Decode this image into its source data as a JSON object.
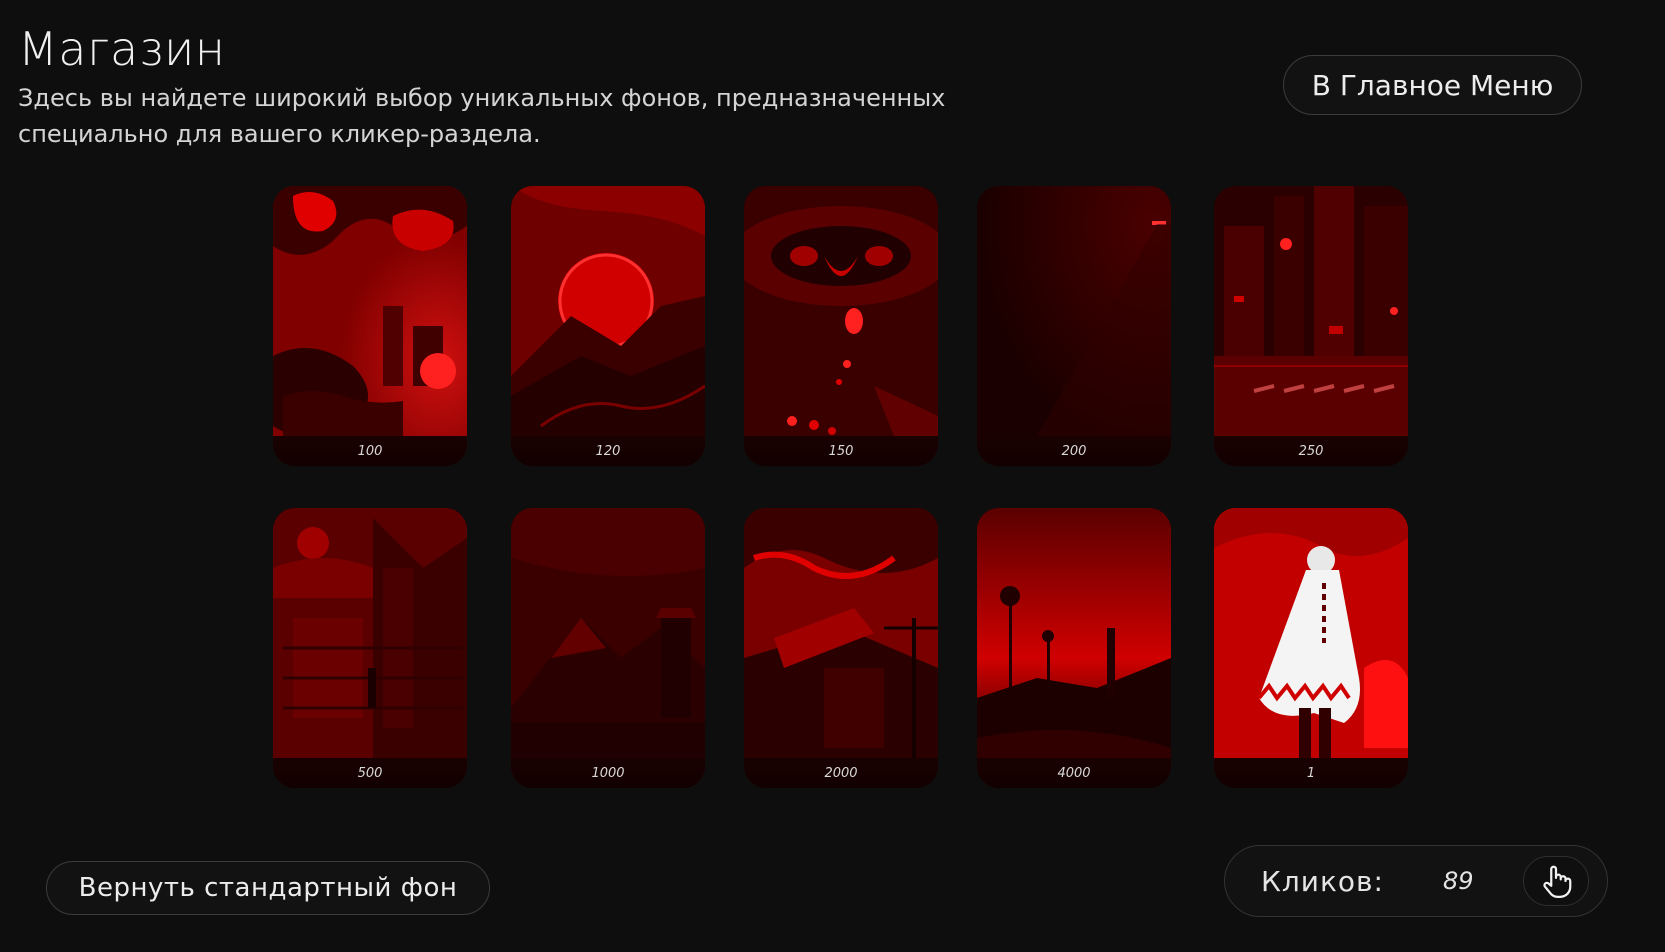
{
  "header": {
    "title": "Магазин",
    "subtitle": "Здесь вы найдете широкий выбор уникальных фонов, предназначенных специально для вашего кликер-раздела."
  },
  "main_menu_button": "В Главное Меню",
  "reset_button": "Вернуть стандартный фон",
  "shop": {
    "items": [
      {
        "price": "100"
      },
      {
        "price": "120"
      },
      {
        "price": "150"
      },
      {
        "price": "200"
      },
      {
        "price": "250"
      },
      {
        "price": "500"
      },
      {
        "price": "1000"
      },
      {
        "price": "2000"
      },
      {
        "price": "4000"
      },
      {
        "price": "1"
      }
    ]
  },
  "counter": {
    "label": "Кликов:",
    "value": "89",
    "icon": "hand-pointer-icon"
  },
  "colors": {
    "background": "#0e0e0e",
    "accent": "#d40000"
  }
}
